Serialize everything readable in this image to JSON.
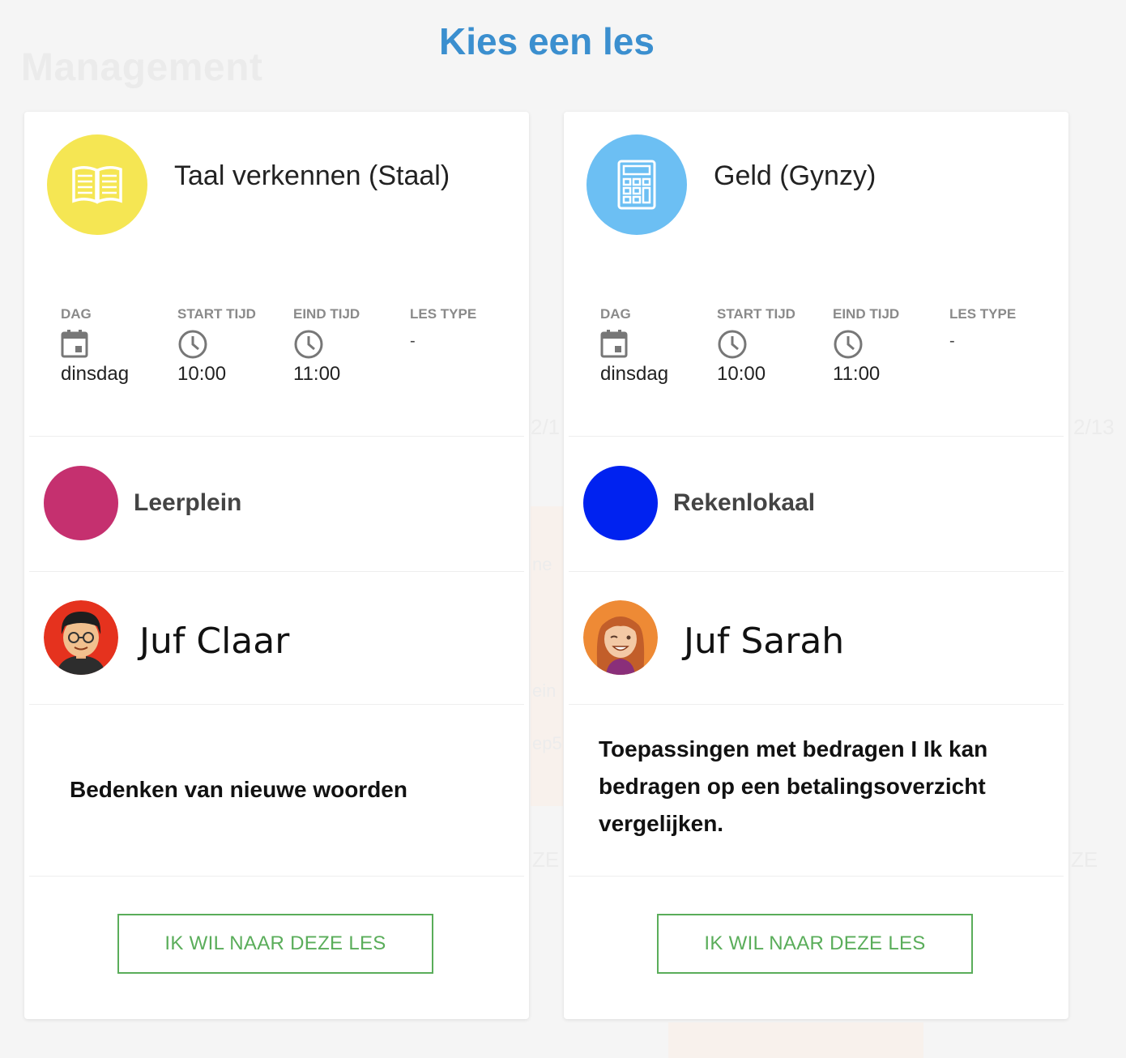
{
  "background": {
    "section_title": "Management",
    "ghost_texts": [
      "2/1",
      "2/13",
      "ne",
      "ein",
      "ep5",
      "ZE",
      "ZE"
    ]
  },
  "modal": {
    "title": "Kies een les"
  },
  "colors": {
    "title_blue": "#3b8fcf",
    "cta_green": "#5aad5a"
  },
  "info_labels": {
    "day": "DAG",
    "start": "START TIJD",
    "end": "EIND TIJD",
    "type": "LES TYPE"
  },
  "cards": [
    {
      "subject": "Taal verkennen (Staal)",
      "subject_icon": "open-book-icon",
      "subject_color": "#f5e653",
      "day": "dinsdag",
      "start": "10:00",
      "end": "11:00",
      "les_type": "-",
      "room": "Leerplein",
      "room_color": "#c5306f",
      "teacher": "Juf Claar",
      "description": "Bedenken van nieuwe woorden",
      "cta": "IK WIL NAAR DEZE LES"
    },
    {
      "subject": "Geld (Gynzy)",
      "subject_icon": "calculator-icon",
      "subject_color": "#6cbff3",
      "day": "dinsdag",
      "start": "10:00",
      "end": "11:00",
      "les_type": "-",
      "room": "Rekenlokaal",
      "room_color": "#0022f0",
      "teacher": "Juf Sarah",
      "description": "Toepassingen met bedragen I Ik kan bedragen op een betalingsoverzicht vergelijken.",
      "cta": "IK WIL NAAR DEZE LES"
    }
  ]
}
